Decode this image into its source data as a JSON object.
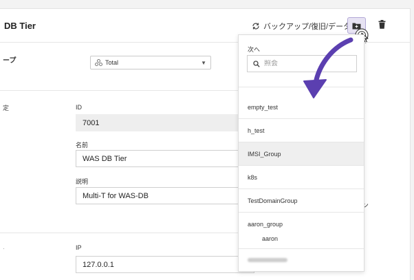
{
  "header": {
    "title": "DB Tier",
    "backup_link": "バックアップ/復旧/データ"
  },
  "group_section": {
    "label": "ープ",
    "select_value": "Total"
  },
  "settings_section": {
    "label": "定",
    "id_label": "ID",
    "id_value": "7001",
    "name_label": "名前",
    "name_value": "WAS DB Tier",
    "desc_label": "説明",
    "desc_value": "Multi-T for WAS-DB"
  },
  "ip_section": {
    "ip_label": "IP",
    "ip_value": "127.0.0.1"
  },
  "stray_text": "ン",
  "dropdown": {
    "label": "次へ",
    "search_placeholder": "照会",
    "items": [
      {
        "label": "empty_test"
      },
      {
        "label": "h_test"
      },
      {
        "label": "IMSI_Group"
      },
      {
        "label": "k8s"
      },
      {
        "label": "TestDomainGroup"
      },
      {
        "label": "aaron_group"
      }
    ],
    "subitem": "aaron"
  },
  "colors": {
    "accent_purple": "#5b3fb0",
    "button_bg": "#e7e3f3"
  }
}
